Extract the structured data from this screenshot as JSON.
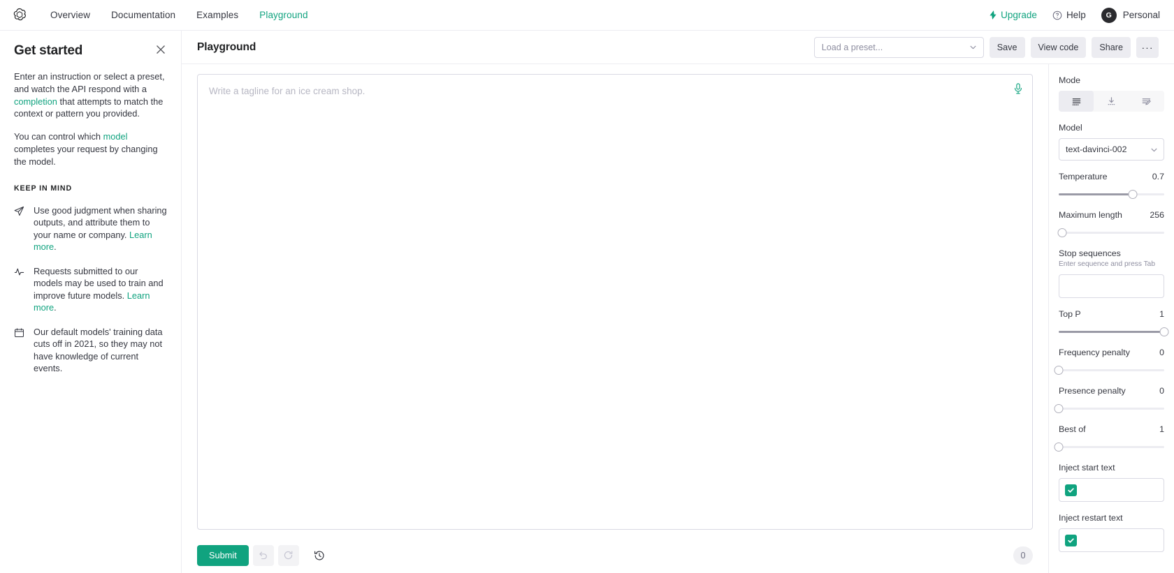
{
  "nav": {
    "logo_icon": "openai-logo-icon",
    "links": [
      {
        "label": "Overview",
        "active": false
      },
      {
        "label": "Documentation",
        "active": false
      },
      {
        "label": "Examples",
        "active": false
      },
      {
        "label": "Playground",
        "active": true
      }
    ],
    "upgrade_label": "Upgrade",
    "upgrade_icon": "lightning-bolt-icon",
    "help_label": "Help",
    "help_icon": "question-circle-icon",
    "account_label": "Personal",
    "avatar_initial": "G"
  },
  "sidebar": {
    "title": "Get started",
    "close_icon": "close-icon",
    "paragraph1_part1": "Enter an instruction or select a preset, and watch the API respond with a ",
    "paragraph1_link": "completion",
    "paragraph1_part2": " that attempts to match the context or pattern you provided.",
    "paragraph2_part1": "You can control which ",
    "paragraph2_link": "model",
    "paragraph2_part2": " completes your request by changing the model.",
    "keep_in_mind_heading": "KEEP IN MIND",
    "items": [
      {
        "icon": "paper-plane-icon",
        "text": "Use good judgment when sharing outputs, and attribute them to your name or company. ",
        "link": "Learn more",
        "suffix": "."
      },
      {
        "icon": "activity-pulse-icon",
        "text": "Requests submitted to our models may be used to train and improve future models. ",
        "link": "Learn more",
        "suffix": "."
      },
      {
        "icon": "calendar-icon",
        "text": "Our default models' training data cuts off in 2021, so they may not have knowledge of current events.",
        "link": "",
        "suffix": ""
      }
    ]
  },
  "playground": {
    "title": "Playground",
    "preset_placeholder": "Load a preset...",
    "preset_caret_icon": "chevron-down-icon",
    "save_label": "Save",
    "view_code_label": "View code",
    "share_label": "Share",
    "more_label": "···"
  },
  "prompt": {
    "placeholder": "Write a tagline for an ice cream shop.",
    "value": "",
    "mic_icon": "microphone-icon"
  },
  "footer": {
    "submit_label": "Submit",
    "undo_icon": "undo-arrow-icon",
    "regenerate_icon": "refresh-arrow-icon",
    "history_icon": "clock-history-icon",
    "token_count": "0"
  },
  "settings": {
    "mode": {
      "label": "Mode",
      "options": [
        {
          "icon": "complete-lines-icon",
          "selected": true
        },
        {
          "icon": "insert-download-icon",
          "selected": false
        },
        {
          "icon": "edit-pencil-lines-icon",
          "selected": false
        }
      ]
    },
    "model": {
      "label": "Model",
      "value": "text-davinci-002",
      "caret_icon": "chevron-down-icon"
    },
    "sliders": [
      {
        "label": "Temperature",
        "value": "0.7",
        "percent": 70
      },
      {
        "label": "Maximum length",
        "value": "256",
        "percent": 3
      },
      {
        "label": "Top P",
        "value": "1",
        "percent": 100
      },
      {
        "label": "Frequency penalty",
        "value": "0",
        "percent": 0
      },
      {
        "label": "Presence penalty",
        "value": "0",
        "percent": 0
      },
      {
        "label": "Best of",
        "value": "1",
        "percent": 0
      }
    ],
    "stop_sequences": {
      "label": "Stop sequences",
      "hint": "Enter sequence and press Tab",
      "value": ""
    },
    "inject_start_text": {
      "label": "Inject start text",
      "checked": true
    },
    "inject_restart_text": {
      "label": "Inject restart text",
      "checked": true
    }
  },
  "colors": {
    "accent": "#10a37f",
    "border": "#d9d9e3",
    "muted": "#8e8ea0"
  }
}
